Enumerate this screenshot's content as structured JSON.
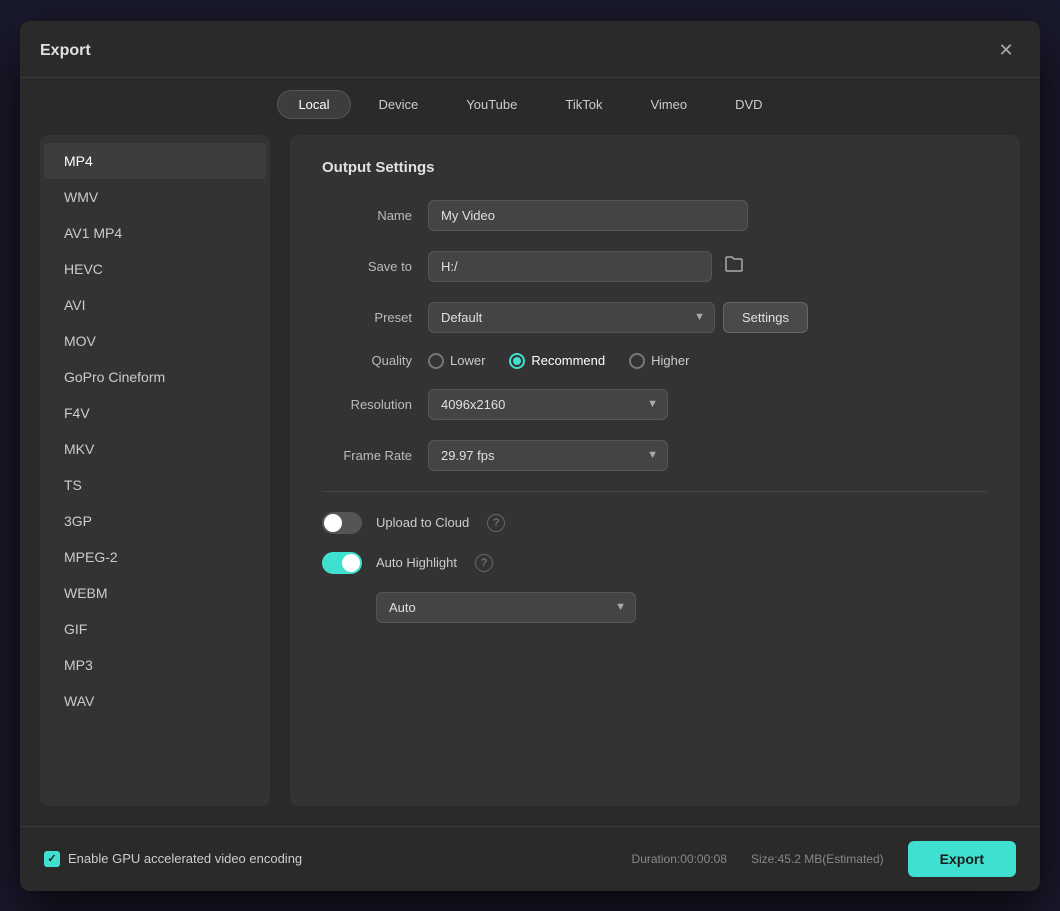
{
  "dialog": {
    "title": "Export",
    "close_label": "✕"
  },
  "tabs": [
    {
      "id": "local",
      "label": "Local",
      "active": true
    },
    {
      "id": "device",
      "label": "Device",
      "active": false
    },
    {
      "id": "youtube",
      "label": "YouTube",
      "active": false
    },
    {
      "id": "tiktok",
      "label": "TikTok",
      "active": false
    },
    {
      "id": "vimeo",
      "label": "Vimeo",
      "active": false
    },
    {
      "id": "dvd",
      "label": "DVD",
      "active": false
    }
  ],
  "formats": [
    {
      "id": "mp4",
      "label": "MP4",
      "active": true
    },
    {
      "id": "wmv",
      "label": "WMV",
      "active": false
    },
    {
      "id": "av1mp4",
      "label": "AV1 MP4",
      "active": false
    },
    {
      "id": "hevc",
      "label": "HEVC",
      "active": false
    },
    {
      "id": "avi",
      "label": "AVI",
      "active": false
    },
    {
      "id": "mov",
      "label": "MOV",
      "active": false
    },
    {
      "id": "goprocineform",
      "label": "GoPro Cineform",
      "active": false
    },
    {
      "id": "f4v",
      "label": "F4V",
      "active": false
    },
    {
      "id": "mkv",
      "label": "MKV",
      "active": false
    },
    {
      "id": "ts",
      "label": "TS",
      "active": false
    },
    {
      "id": "3gp",
      "label": "3GP",
      "active": false
    },
    {
      "id": "mpeg2",
      "label": "MPEG-2",
      "active": false
    },
    {
      "id": "webm",
      "label": "WEBM",
      "active": false
    },
    {
      "id": "gif",
      "label": "GIF",
      "active": false
    },
    {
      "id": "mp3",
      "label": "MP3",
      "active": false
    },
    {
      "id": "wav",
      "label": "WAV",
      "active": false
    }
  ],
  "output_settings": {
    "section_title": "Output Settings",
    "name_label": "Name",
    "name_value": "My Video",
    "save_to_label": "Save to",
    "save_to_value": "H:/",
    "folder_icon": "📁",
    "preset_label": "Preset",
    "preset_value": "Default",
    "settings_btn_label": "Settings",
    "quality_label": "Quality",
    "quality_options": [
      {
        "id": "lower",
        "label": "Lower",
        "selected": false
      },
      {
        "id": "recommend",
        "label": "Recommend",
        "selected": true
      },
      {
        "id": "higher",
        "label": "Higher",
        "selected": false
      }
    ],
    "resolution_label": "Resolution",
    "resolution_value": "4096x2160",
    "frame_rate_label": "Frame Rate",
    "frame_rate_value": "29.97 fps",
    "upload_cloud_label": "Upload to Cloud",
    "upload_cloud_on": false,
    "auto_highlight_label": "Auto Highlight",
    "auto_highlight_on": true,
    "auto_select_value": "Auto",
    "help_icon": "?"
  },
  "footer": {
    "gpu_label": "Enable GPU accelerated video encoding",
    "duration_label": "Duration:00:00:08",
    "size_label": "Size:45.2 MB(Estimated)",
    "export_label": "Export"
  }
}
